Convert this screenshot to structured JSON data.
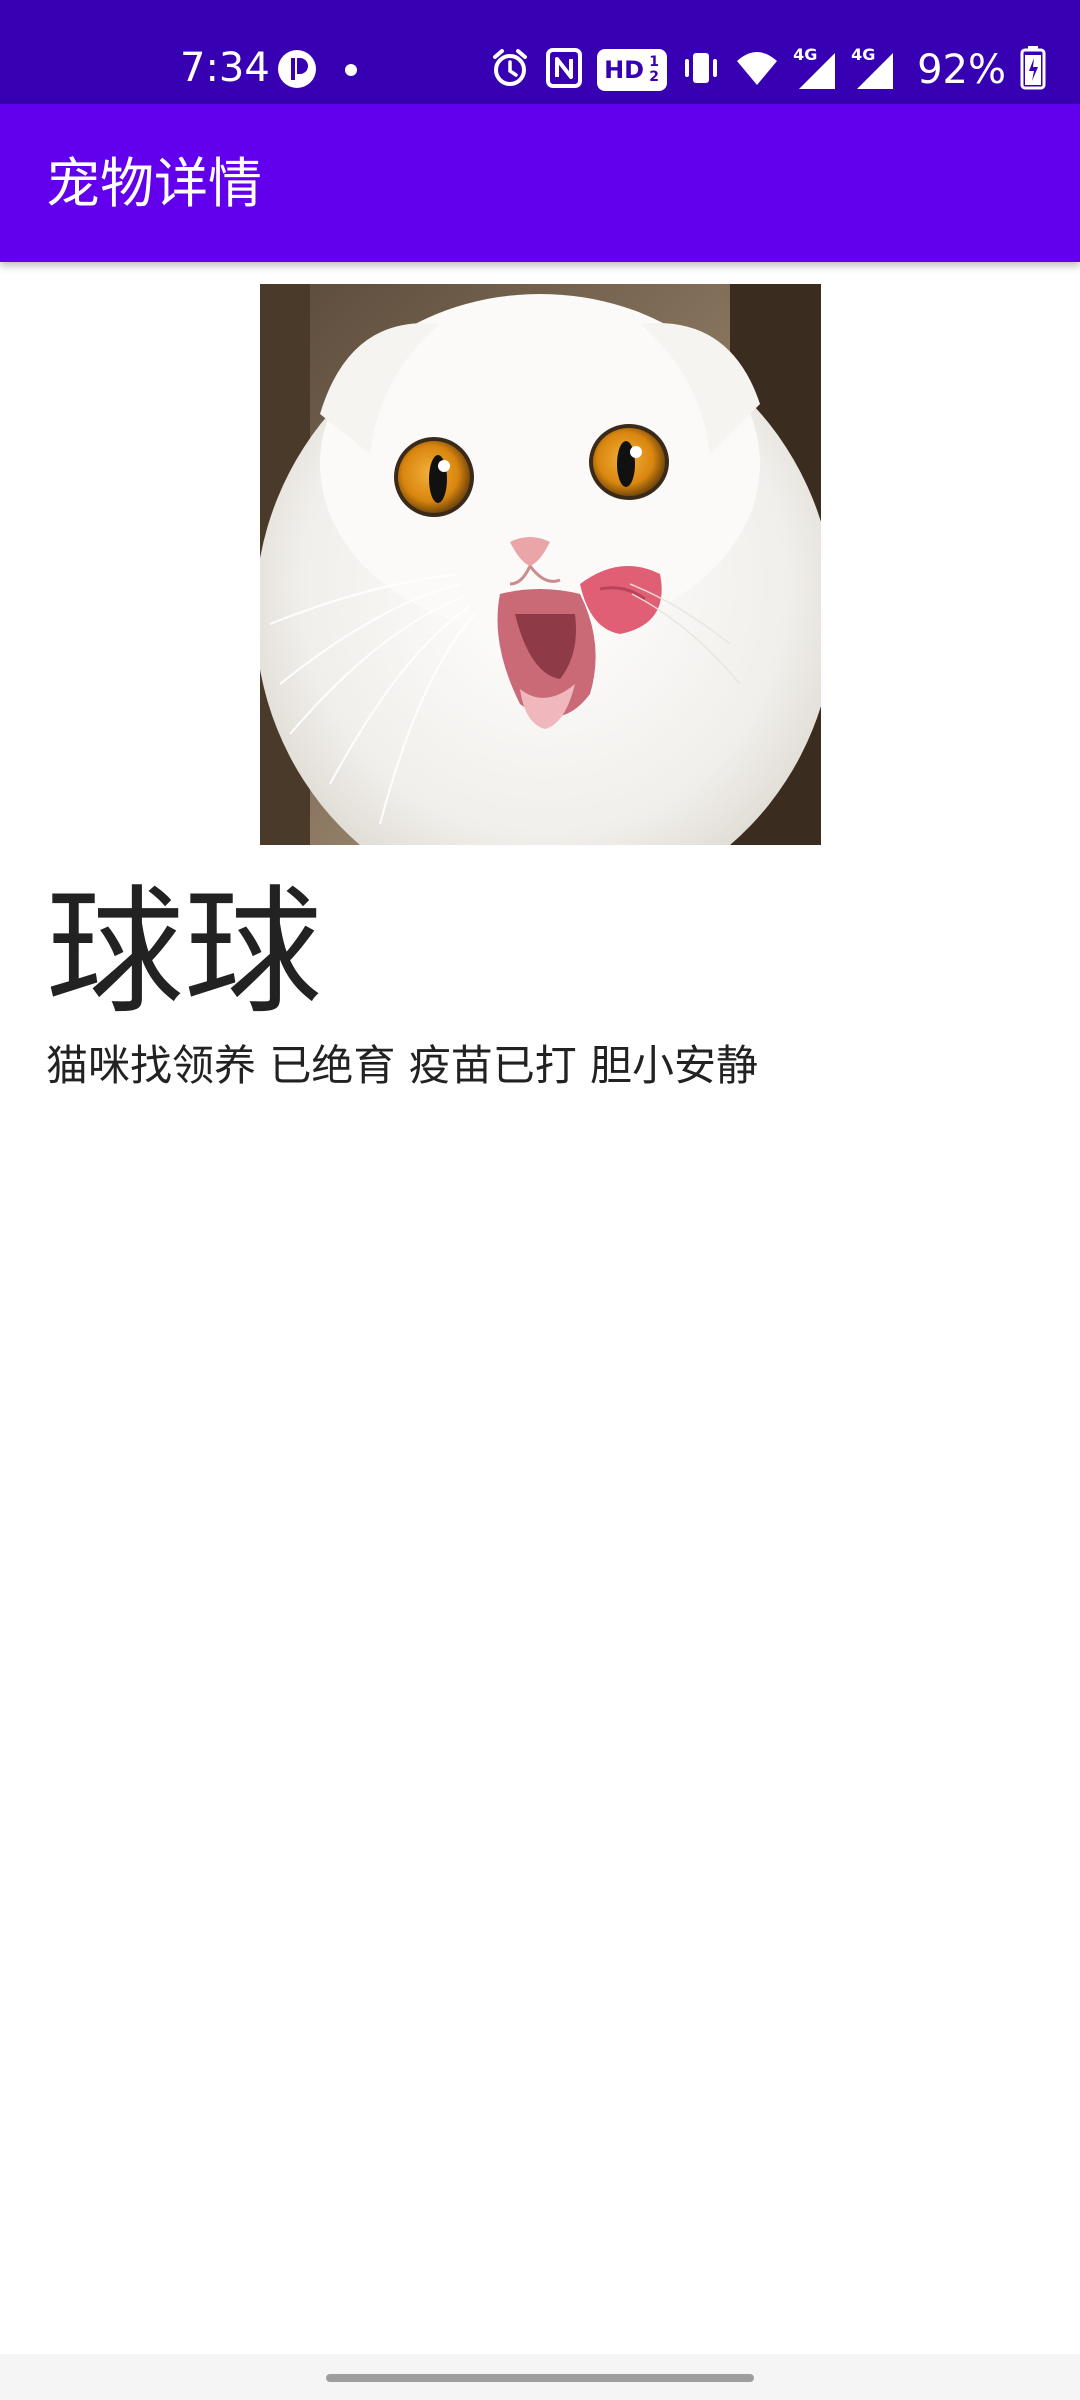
{
  "status_bar": {
    "time": "7:34",
    "icons_left": [
      "app-notification-icon",
      "dot-icon"
    ],
    "icons_right": [
      "alarm-icon",
      "nfc-icon",
      "hd-voice-icon",
      "vibrate-icon",
      "wifi-icon",
      "signal-4g-icon",
      "signal-4g-icon"
    ],
    "hd_label": "HD",
    "hd_sub": "1 2",
    "network_label": "4G",
    "battery": "92%"
  },
  "toolbar": {
    "title": "宠物详情"
  },
  "pet": {
    "name": "球球",
    "description": "猫咪找领养 已绝育 疫苗已打 胆小安静"
  },
  "colors": {
    "status_bar": "#3700b3",
    "toolbar": "#6200ee",
    "text": "#222222",
    "background": "#ffffff"
  }
}
